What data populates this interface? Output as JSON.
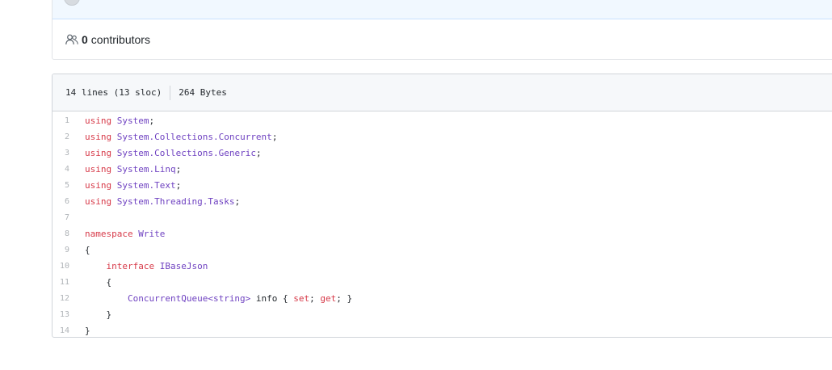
{
  "contributors": {
    "count": "0",
    "label": "contributors"
  },
  "file": {
    "lines_info": "14 lines (13 sloc)",
    "size": "264 Bytes"
  },
  "code_lines": [
    {
      "num": "1",
      "tokens": [
        {
          "t": "kw",
          "v": "using"
        },
        {
          "t": "pl",
          "v": " "
        },
        {
          "t": "ent",
          "v": "System"
        },
        {
          "t": "pl",
          "v": ";"
        }
      ]
    },
    {
      "num": "2",
      "tokens": [
        {
          "t": "kw",
          "v": "using"
        },
        {
          "t": "pl",
          "v": " "
        },
        {
          "t": "ent",
          "v": "System.Collections.Concurrent"
        },
        {
          "t": "pl",
          "v": ";"
        }
      ]
    },
    {
      "num": "3",
      "tokens": [
        {
          "t": "kw",
          "v": "using"
        },
        {
          "t": "pl",
          "v": " "
        },
        {
          "t": "ent",
          "v": "System.Collections.Generic"
        },
        {
          "t": "pl",
          "v": ";"
        }
      ]
    },
    {
      "num": "4",
      "tokens": [
        {
          "t": "kw",
          "v": "using"
        },
        {
          "t": "pl",
          "v": " "
        },
        {
          "t": "ent",
          "v": "System.Linq"
        },
        {
          "t": "pl",
          "v": ";"
        }
      ]
    },
    {
      "num": "5",
      "tokens": [
        {
          "t": "kw",
          "v": "using"
        },
        {
          "t": "pl",
          "v": " "
        },
        {
          "t": "ent",
          "v": "System.Text"
        },
        {
          "t": "pl",
          "v": ";"
        }
      ]
    },
    {
      "num": "6",
      "tokens": [
        {
          "t": "kw",
          "v": "using"
        },
        {
          "t": "pl",
          "v": " "
        },
        {
          "t": "ent",
          "v": "System.Threading.Tasks"
        },
        {
          "t": "pl",
          "v": ";"
        }
      ]
    },
    {
      "num": "7",
      "tokens": []
    },
    {
      "num": "8",
      "tokens": [
        {
          "t": "kw",
          "v": "namespace"
        },
        {
          "t": "pl",
          "v": " "
        },
        {
          "t": "ent",
          "v": "Write"
        }
      ]
    },
    {
      "num": "9",
      "tokens": [
        {
          "t": "pl",
          "v": "{"
        }
      ]
    },
    {
      "num": "10",
      "tokens": [
        {
          "t": "pl",
          "v": "    "
        },
        {
          "t": "kw",
          "v": "interface"
        },
        {
          "t": "pl",
          "v": " "
        },
        {
          "t": "ent",
          "v": "IBaseJson"
        }
      ]
    },
    {
      "num": "11",
      "tokens": [
        {
          "t": "pl",
          "v": "    {"
        }
      ]
    },
    {
      "num": "12",
      "tokens": [
        {
          "t": "pl",
          "v": "        "
        },
        {
          "t": "ent",
          "v": "ConcurrentQueue<string>"
        },
        {
          "t": "pl",
          "v": " info { "
        },
        {
          "t": "kw",
          "v": "set"
        },
        {
          "t": "pl",
          "v": "; "
        },
        {
          "t": "kw",
          "v": "get"
        },
        {
          "t": "pl",
          "v": "; }"
        }
      ]
    },
    {
      "num": "13",
      "tokens": [
        {
          "t": "pl",
          "v": "    }"
        }
      ]
    },
    {
      "num": "14",
      "tokens": [
        {
          "t": "pl",
          "v": "}"
        }
      ]
    }
  ],
  "colors": {
    "keyword": "#d73a49",
    "entity": "#6f42c1",
    "plain": "#24292e",
    "line_number": "#b0b4b8",
    "header_bg": "#f6f8fa"
  }
}
